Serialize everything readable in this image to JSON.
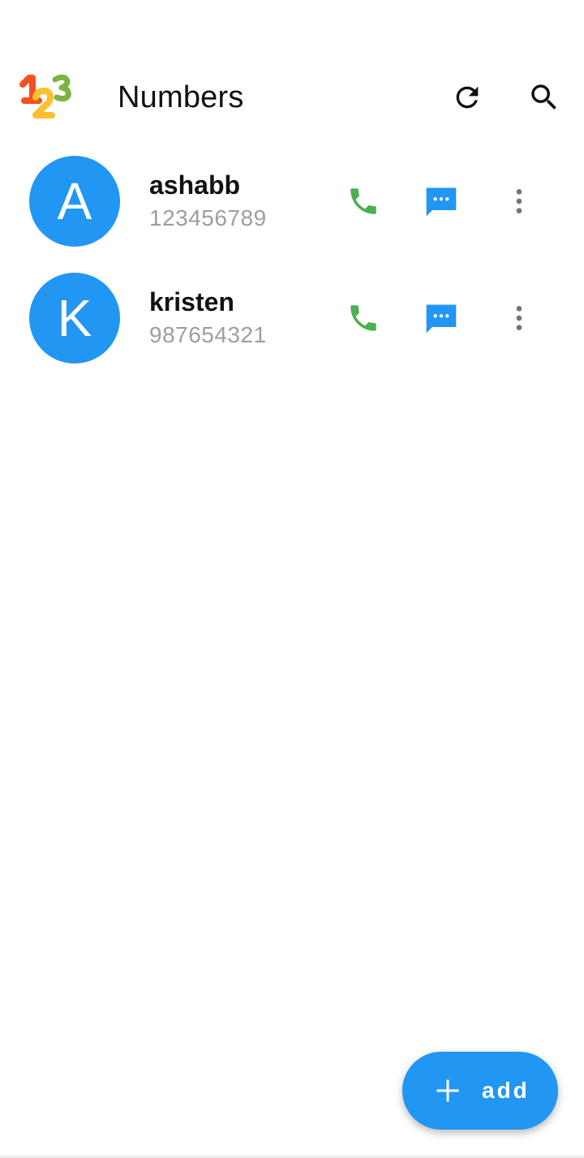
{
  "app_bar": {
    "title": "Numbers",
    "logo_icon": "numbers-123-logo-icon",
    "refresh_icon": "refresh-icon",
    "search_icon": "search-icon"
  },
  "contacts": [
    {
      "initial": "A",
      "name": "ashabb",
      "number": "123456789"
    },
    {
      "initial": "K",
      "name": "kristen",
      "number": "987654321"
    }
  ],
  "row_actions": {
    "call_icon": "phone-icon",
    "sms_icon": "message-icon",
    "more_icon": "more-vertical-icon"
  },
  "fab": {
    "label": "add",
    "icon": "plus-icon"
  },
  "colors": {
    "accent": "#2196f3",
    "call_green": "#4caf50",
    "secondary_text": "#9e9e9e",
    "more_icon_gray": "#757575"
  }
}
